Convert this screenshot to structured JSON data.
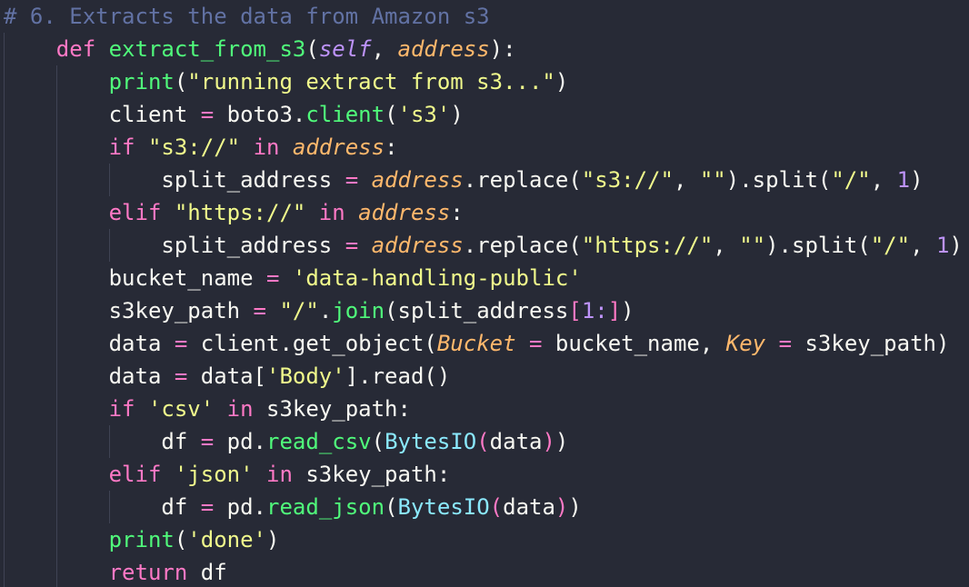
{
  "code": {
    "l1_comment": "# 6. Extracts the data from Amazon s3",
    "l2_def": "def",
    "l2_name": "extract_from_s3",
    "l2_self": "self",
    "l2_param": "address",
    "l3_print": "print",
    "l3_str": "\"running extract from s3...\"",
    "l4_var": "client",
    "l4_mod": "boto3.",
    "l4_call": "client",
    "l4_str": "'s3'",
    "l5_if": "if",
    "l5_str": "\"s3://\"",
    "l5_in": "in",
    "l5_addr": "address",
    "l6_var": "split_address",
    "l6_addr": "address",
    "l6_method": ".replace(",
    "l6_str1": "\"s3://\"",
    "l6_str2": "\"\"",
    "l6_method2": ").split(",
    "l6_str3": "\"/\"",
    "l6_num": "1",
    "l7_elif": "elif",
    "l7_str": "\"https://\"",
    "l7_in": "in",
    "l7_addr": "address",
    "l8_var": "split_address",
    "l8_addr": "address",
    "l8_method": ".replace(",
    "l8_str1": "\"https://\"",
    "l8_str2": "\"\"",
    "l8_method2": ").split(",
    "l8_str3": "\"/\"",
    "l8_num": "1",
    "l9_var": "bucket_name",
    "l9_str": "'data-handling-public'",
    "l10_var": "s3key_path",
    "l10_str": "\"/\"",
    "l10_join": "join",
    "l10_arg": "split_address",
    "l10_slice": "1:",
    "l11_var": "data",
    "l11_call": "client.get_object(",
    "l11_kw1": "Bucket",
    "l11_v1": "bucket_name",
    "l11_kw2": "Key",
    "l11_v2": "s3key_path",
    "l12_var": "data",
    "l12_obj": "data",
    "l12_str": "'Body'",
    "l12_tail": ".read()",
    "l13_if": "if",
    "l13_str": "'csv'",
    "l13_in": "in",
    "l13_var": "s3key_path:",
    "l14_var": "df",
    "l14_mod": "pd.",
    "l14_call": "read_csv",
    "l14_cls": "BytesIO",
    "l14_arg": "data",
    "l15_elif": "elif",
    "l15_str": "'json'",
    "l15_in": "in",
    "l15_var": "s3key_path:",
    "l16_var": "df",
    "l16_mod": "pd.",
    "l16_call": "read_json",
    "l16_cls": "BytesIO",
    "l16_arg": "data",
    "l17_print": "print",
    "l17_str": "'done'",
    "l18_return": "return",
    "l18_var": "df"
  },
  "colors": {
    "background": "#272a36",
    "keyword": "#ff79c6",
    "function": "#50fa7b",
    "string": "#f1fa8c",
    "parameter": "#ffb86c",
    "number": "#bd93f9",
    "class": "#8be9fd",
    "comment": "#6272a4",
    "text": "#f8f8f2"
  }
}
